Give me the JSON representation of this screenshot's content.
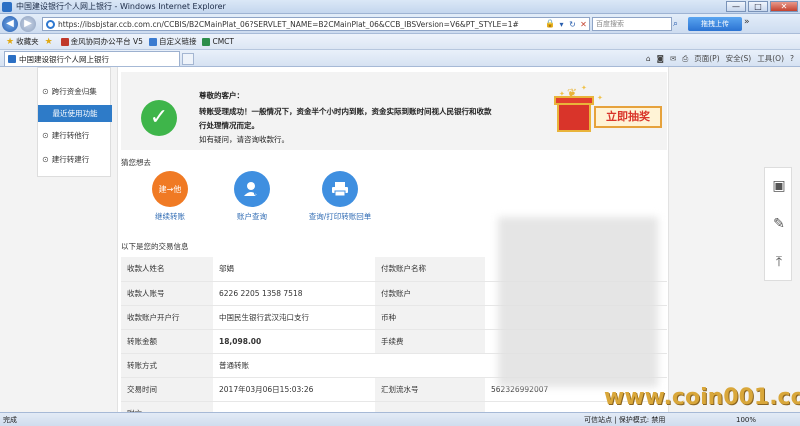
{
  "window": {
    "title": "中国建设银行个人网上银行 - Windows Internet Explorer",
    "controls": [
      "—",
      "□",
      "✕"
    ]
  },
  "address_bar": {
    "url": "https://ibsbjstar.ccb.com.cn/CCBIS/B2CMainPlat_06?SERVLET_NAME=B2CMainPlat_06&CCB_IBSVersion=V6&PT_STYLE=1#",
    "search_placeholder": "百度搜索",
    "upload_button": "拖拽上传"
  },
  "favorites_bar": {
    "favorites_label": "收藏夹",
    "items": [
      "金风协同办公平台 V5",
      "自定义链接",
      "CMCT"
    ]
  },
  "tab": {
    "label": "中国建设银行个人网上银行"
  },
  "command_bar": {
    "page": "页面(P)",
    "safety": "安全(S)",
    "tools": "工具(O)",
    "help": "?"
  },
  "sidebar": {
    "items": [
      {
        "label": "跨行资金归集",
        "icon": "⊙"
      },
      {
        "label": "转他行",
        "icon": "⊙"
      },
      {
        "label": "建行转建行",
        "icon": "⊙"
      }
    ],
    "section_header": "最近使用功能",
    "recent_items": [
      {
        "label": "建行转他行",
        "icon": "⊙"
      },
      {
        "label": "建行转建行",
        "icon": "⊙"
      }
    ]
  },
  "result": {
    "greeting": "尊敬的客户：",
    "line1": "转账受理成功！一般情况下，资金半个小时内到账，资金实际到账时间视人民银行和收款",
    "line2": "行处理情况而定。",
    "line3": "如有疑问，请咨询收款行。",
    "lottery": "立即抽奖"
  },
  "guess": {
    "label": "猜您想去",
    "actions": [
      {
        "label": "继续转账",
        "icon_text": "建→他",
        "color": "#f07a24"
      },
      {
        "label": "账户查询",
        "icon_text": "",
        "color": "#3f8fe0"
      },
      {
        "label": "查询/打印转账回单",
        "icon_text": "",
        "color": "#3f8fe0"
      }
    ]
  },
  "info": {
    "label": "以下是您的交易信息",
    "rows": [
      {
        "l1": "收款人姓名",
        "v1": "邬娟",
        "l2": "付款账户名称",
        "v2": ""
      },
      {
        "l1": "收款人账号",
        "v1": "6226 2205 1358 7518",
        "l2": "付款账户",
        "v2": ""
      },
      {
        "l1": "收款账户开户行",
        "v1": "中国民生银行武汉沌口支行",
        "l2": "币种",
        "v2": ""
      },
      {
        "l1": "转账金额",
        "v1": "18,098.00",
        "l2": "手续费",
        "v2": ""
      },
      {
        "l1": "转账方式",
        "v1": "普通转账",
        "l2": "",
        "v2": ""
      },
      {
        "l1": "交易时间",
        "v1": "2017年03月06日15:03:26",
        "l2": "汇划流水号",
        "v2": "562326992007"
      },
      {
        "l1": "附言",
        "v1": "…",
        "l2": "",
        "v2": ""
      }
    ]
  },
  "watermark": "www.coin001.com",
  "status": {
    "left": "完成",
    "zone": "可信站点 | 保护模式: 禁用",
    "zoom": "100%"
  },
  "colors": {
    "accent_blue": "#2e7bc8",
    "success_green": "#3eb54a",
    "amount_red": "#d9342a"
  }
}
